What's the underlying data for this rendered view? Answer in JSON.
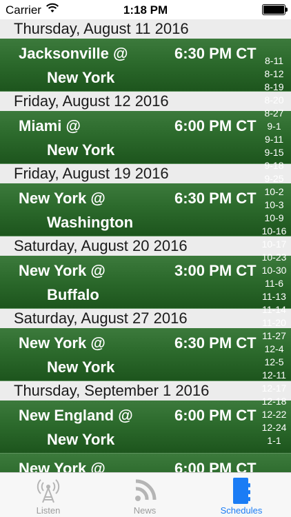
{
  "status_bar": {
    "carrier": "Carrier",
    "time": "1:18 PM"
  },
  "schedule": [
    {
      "day": "Thursday, August 11 2016",
      "away": "Jacksonville @",
      "home": "New York",
      "time": "6:30 PM CT"
    },
    {
      "day": "Friday, August 12 2016",
      "away": "Miami @",
      "home": "New York",
      "time": "6:00 PM CT"
    },
    {
      "day": "Friday, August 19 2016",
      "away": "New York @",
      "home": "Washington",
      "time": "6:30 PM CT"
    },
    {
      "day": "Saturday, August 20 2016",
      "away": "New York @",
      "home": "Buffalo",
      "time": "3:00 PM CT"
    },
    {
      "day": "Saturday, August 27 2016",
      "away": "New York @",
      "home": "New York",
      "time": "6:30 PM CT"
    },
    {
      "day": "Thursday, September 1 2016",
      "away": "New England @",
      "home": "New York",
      "time": "6:00 PM CT"
    },
    {
      "day": "",
      "away": "New York @",
      "home": "",
      "time": "6:00 PM CT"
    }
  ],
  "date_index": [
    "8-11",
    "8-12",
    "8-19",
    "8-20",
    "8-27",
    "9-1",
    "9-11",
    "9-15",
    "9-18",
    "9-25",
    "10-2",
    "10-3",
    "10-9",
    "10-16",
    "10-17",
    "10-23",
    "10-30",
    "11-6",
    "11-13",
    "11-14",
    "11-20",
    "11-27",
    "12-4",
    "12-5",
    "12-11",
    "12-17",
    "12-18",
    "12-22",
    "12-24",
    "1-1"
  ],
  "tabs": [
    {
      "label": "Listen",
      "icon": "antenna-icon",
      "active": false
    },
    {
      "label": "News",
      "icon": "rss-icon",
      "active": false
    },
    {
      "label": "Schedules",
      "icon": "calendar-icon",
      "active": true
    }
  ],
  "colors": {
    "accent": "#1a7cf5",
    "green_top": "#3c7a3c",
    "green_bottom": "#1d551d",
    "header_bg": "#ececec"
  }
}
